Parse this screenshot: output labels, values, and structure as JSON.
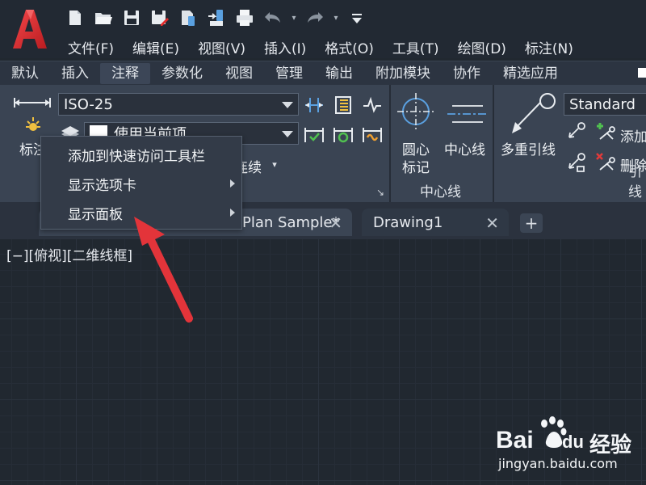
{
  "app": {
    "logo_letter": "A",
    "brand_color": "#e32b2b"
  },
  "quick_access": {
    "icons": [
      "new-icon",
      "open-icon",
      "save-icon",
      "save-as-icon",
      "open-web-mobile-icon",
      "save-web-mobile-icon",
      "plot-icon",
      "undo-icon",
      "redo-icon",
      "customize-icon"
    ]
  },
  "menubar": {
    "items": [
      "文件(F)",
      "编辑(E)",
      "视图(V)",
      "插入(I)",
      "格式(O)",
      "工具(T)",
      "绘图(D)",
      "标注(N)"
    ]
  },
  "ribbon_tabs": {
    "items": [
      "默认",
      "插入",
      "注释",
      "参数化",
      "视图",
      "管理",
      "输出",
      "附加模块",
      "协作",
      "精选应用"
    ],
    "active_index": 2
  },
  "ribbon": {
    "dimension_style_value": "ISO-25",
    "layer_value": "使用当前项",
    "dimension_button_label": "标注",
    "continue_label": "连续",
    "centermark_label_line1": "圆心",
    "centermark_label_line2": "标记",
    "centerline_label": "中心线",
    "centerline_panel_title": "中心线",
    "mleader_label": "多重引线",
    "mleader_style_value": "Standard",
    "add_leader_label": "添加",
    "remove_leader_label": "删除",
    "leader_panel_title": "引线"
  },
  "doc_tabs": {
    "items": [
      {
        "label": "Plan Sample*",
        "close": "✕"
      },
      {
        "label": "Drawing1",
        "close": "✕"
      }
    ],
    "new_tab": "+"
  },
  "viewport": {
    "label": "[−][俯视][二维线框]"
  },
  "context_menu": {
    "items": [
      {
        "label": "添加到快速访问工具栏",
        "has_submenu": false
      },
      {
        "label": "显示选项卡",
        "has_submenu": true
      },
      {
        "label": "显示面板",
        "has_submenu": true
      }
    ]
  },
  "annotation": {
    "arrow_color": "#e3343a"
  },
  "watermark": {
    "brand": "Bai",
    "brand_suffix": "du",
    "product": "经验",
    "url": "jingyan.baidu.com"
  }
}
